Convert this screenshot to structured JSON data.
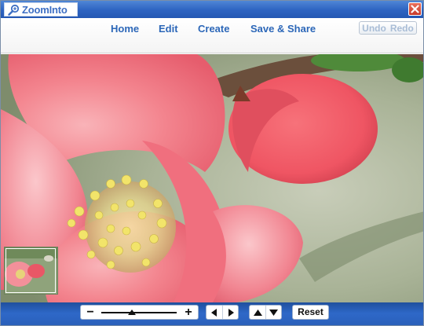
{
  "app": {
    "logo_text": "ZoomInto",
    "logo_icon": "magnifier-icon",
    "close_icon": "close-icon"
  },
  "menu": {
    "items": [
      "Home",
      "Edit",
      "Create",
      "Save & Share"
    ],
    "undo_label": "Undo",
    "redo_label": "Redo"
  },
  "toolbar": {
    "zoom_out_label": "−",
    "zoom_in_label": "+",
    "zoom_level_fraction": 0.41,
    "pan_left_icon": "arrow-left-icon",
    "pan_right_icon": "arrow-right-icon",
    "pan_up_icon": "arrow-up-icon",
    "pan_down_icon": "arrow-down-icon",
    "reset_label": "Reset"
  },
  "colors": {
    "titlebar": "#2d63c1",
    "menu_text": "#2c67b8",
    "toolbar": "#2e68c8",
    "close": "#c7392a"
  }
}
